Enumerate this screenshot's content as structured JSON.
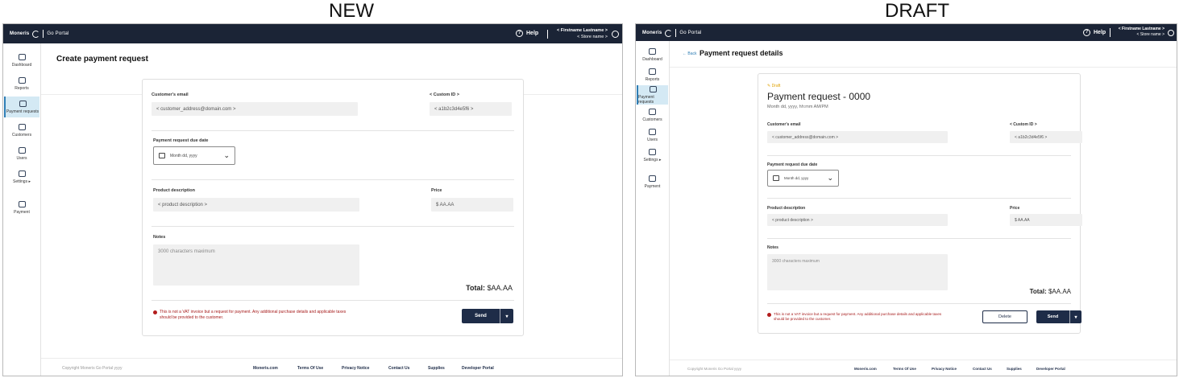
{
  "captions": {
    "left": "NEW",
    "right": "DRAFT"
  },
  "header": {
    "brand": "Moneris",
    "product": "Go Portal",
    "help_label": "Help",
    "user_name": "< Firstname Lastname >",
    "store_name": "< Store name >"
  },
  "sidebar": {
    "dashboard": "Dashboard",
    "reports": "Reports",
    "payment_requests": "Payment requests",
    "customers": "Customers",
    "users": "Users",
    "settings": "Settings ▸",
    "payment": "Payment"
  },
  "new_view": {
    "page_title": "Create payment request",
    "customer_email_label": "Customer's email",
    "customer_email_value": "< customer_address@domain.com >",
    "custom_id_label": "< Custom ID >",
    "custom_id_value": "< a1b2c3d4e5f6 >",
    "due_date_label": "Payment request due date",
    "due_date_value": "Month dd, yyyy",
    "product_description_label": "Product description",
    "product_description_value": "< product description >",
    "price_label": "Price",
    "price_value": "$ AA.AA",
    "notes_label": "Notes",
    "notes_placeholder": "3000 characters maximum",
    "total_label": "Total:",
    "total_value": "$AA.AA",
    "notice_line1": "This is not a VAT invoice but a request for payment. Any additional purchase details and applicable taxes",
    "notice_line2": "should be provided to the customer.",
    "send_label": "Send",
    "send_menu_icon": "▾"
  },
  "draft_view": {
    "back_label": "← Back",
    "page_title": "Payment request details",
    "status_badge": "✎ Draft",
    "request_title": "Payment request - 0000",
    "request_datetime": "Month dd, yyyy, hh:mm AM/PM",
    "customer_email_label": "Customer's email",
    "customer_email_value": "< customer_address@domain.com >",
    "custom_id_label": "< Custom ID >",
    "custom_id_value": "< a1b2c3d4e5f6 >",
    "due_date_label": "Payment request due date",
    "due_date_value": "Month dd, yyyy",
    "product_description_label": "Product description",
    "product_description_value": "< product description >",
    "price_label": "Price",
    "price_value": "$ AA.AA",
    "notes_label": "Notes",
    "notes_placeholder": "3000 characters maximum",
    "total_label": "Total:",
    "total_value": "$AA.AA",
    "notice_line1": "This is not a VAT invoice but a request for payment. Any additional purchase details and applicable taxes",
    "notice_line2": "should be provided to the customer.",
    "delete_label": "Delete",
    "send_label": "Send",
    "send_menu_icon": "▾"
  },
  "footer": {
    "copyright": "Copyright Moneris Go Portal yyyy",
    "links": [
      "Moneris.com",
      "Terms Of Use",
      "Privacy Notice",
      "Contact Us",
      "Supplies",
      "Developer Portal"
    ]
  },
  "colors": {
    "topbar": "#1b2436",
    "active_nav": "#d4e9f4",
    "primary_button": "#1e2c48",
    "error": "#a61b1b",
    "draft_badge": "#e0a200"
  }
}
